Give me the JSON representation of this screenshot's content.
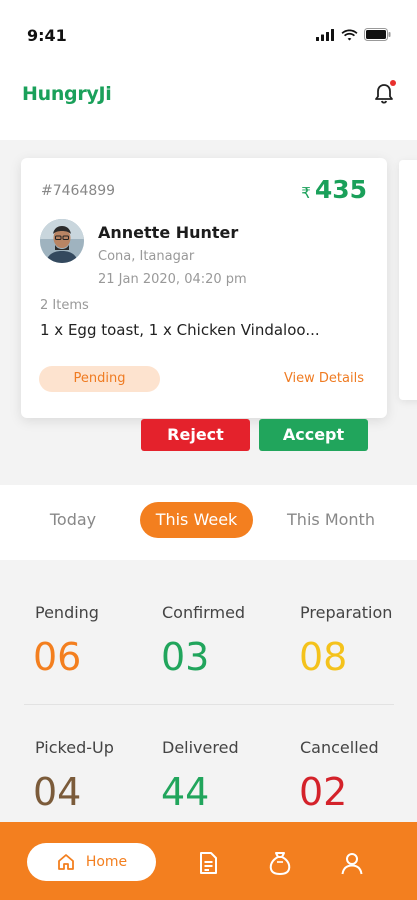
{
  "status_bar": {
    "time": "9:41"
  },
  "header": {
    "logo_text": "HungryJi",
    "bell_icon": "bell-icon"
  },
  "order": {
    "id": "#7464899",
    "currency": "₹",
    "amount": "435",
    "customer_name": "Annette Hunter",
    "location": "Cona, Itanagar",
    "datetime": "21 Jan 2020, 04:20 pm",
    "items_count": "2 Items",
    "items": "1 x Egg toast, 1 x Chicken Vindaloo...",
    "status": "Pending",
    "view_details": "View Details"
  },
  "actions": {
    "reject": "Reject",
    "accept": "Accept"
  },
  "period_tabs": [
    {
      "label": "Today",
      "active": false
    },
    {
      "label": "This Week",
      "active": true
    },
    {
      "label": "This Month",
      "active": false
    }
  ],
  "stats": [
    {
      "label": "Pending",
      "value": "06",
      "color": "#f37f1f"
    },
    {
      "label": "Confirmed",
      "value": "03",
      "color": "#21a55c"
    },
    {
      "label": "Preparation",
      "value": "08",
      "color": "#f4c21b"
    },
    {
      "label": "Picked-Up",
      "value": "04",
      "color": "#7b5b3a"
    },
    {
      "label": "Delivered",
      "value": "44",
      "color": "#21a55c"
    },
    {
      "label": "Cancelled",
      "value": "02",
      "color": "#d4222a"
    }
  ],
  "bottom_nav": {
    "home_label": "Home",
    "items": [
      "home-icon",
      "document-icon",
      "money-bag-icon",
      "user-icon"
    ]
  },
  "colors": {
    "brand_green": "#1aa05a",
    "brand_orange": "#f37f1f",
    "reject_red": "#e4222c"
  }
}
